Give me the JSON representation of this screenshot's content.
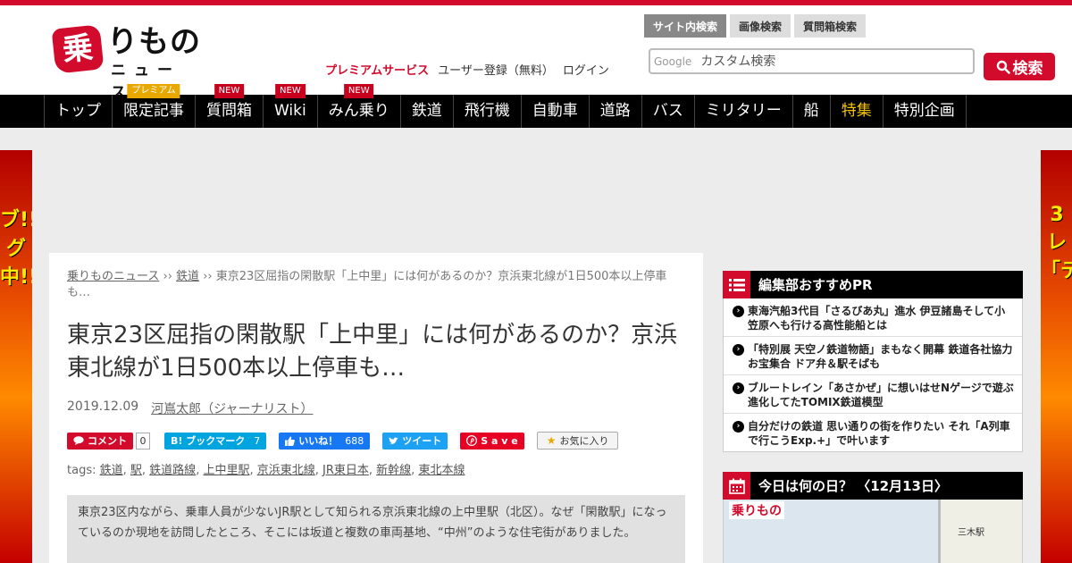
{
  "header": {
    "logo_mark": "乗",
    "logo_text": "りもの",
    "logo_sub": "ニュース",
    "premium_link": "プレミアムサービス",
    "register_link": "ユーザー登録（無料）",
    "login_link": "ログイン",
    "search_tabs": [
      "サイト内検索",
      "画像検索",
      "質問箱検索"
    ],
    "google_label": "Google",
    "search_placeholder": "カスタム検索",
    "search_button": "検索"
  },
  "nav": [
    {
      "label": "トップ",
      "badge": ""
    },
    {
      "label": "限定記事",
      "badge": "プレミアム"
    },
    {
      "label": "質問箱",
      "badge": "NEW"
    },
    {
      "label": "Wiki",
      "badge": "NEW"
    },
    {
      "label": "みん乗り",
      "badge": "NEW"
    },
    {
      "label": "鉄道",
      "badge": ""
    },
    {
      "label": "飛行機",
      "badge": ""
    },
    {
      "label": "自動車",
      "badge": ""
    },
    {
      "label": "道路",
      "badge": ""
    },
    {
      "label": "バス",
      "badge": ""
    },
    {
      "label": "ミリタリー",
      "badge": ""
    },
    {
      "label": "船",
      "badge": ""
    },
    {
      "label": "特集",
      "badge": ""
    },
    {
      "label": "特別企画",
      "badge": ""
    }
  ],
  "side_ads": {
    "left": "ブ!!グ中!!",
    "right": "3レ「テ"
  },
  "article": {
    "breadcrumb": [
      "乗りものニュース",
      "鉄道",
      "東京23区屈指の閑散駅「上中里」には何があるのか？京浜東北線が1日500本以上停車も…"
    ],
    "breadcrumb_sep": "››",
    "title": "東京23区屈指の閑散駅「上中里」には何があるのか？京浜東北線が1日500本以上停車も…",
    "date": "2019.12.09",
    "author": "河嶌太郎（ジャーナリスト）",
    "share": {
      "comment": "コメント",
      "comment_count": "0",
      "hatena": "B! ブックマーク",
      "hatena_count": "7",
      "like": "いいね！",
      "like_count": "688",
      "tweet": "ツイート",
      "pin": "S a v e",
      "fav": "お気に入り"
    },
    "tags_label": "tags:",
    "tags": [
      "鉄道",
      "駅",
      "鉄道路線",
      "上中里駅",
      "京浜東北線",
      "JR東日本",
      "新幹線",
      "東北本線"
    ],
    "lead": "東京23区内ながら、乗車人員が少ないJR駅として知られる京浜東北線の上中里駅（北区）。なぜ「閑散駅」になっているのか現地を訪問したところ、そこには坂道と複数の車両基地、“中州”のような住宅街がありました。"
  },
  "sidebar": {
    "pr_title": "編集部おすすめPR",
    "pr_items": [
      "東海汽船3代目「さるびあ丸」進水 伊豆諸島そして小笠原へも行ける高性能船とは",
      "「特別展 天空ノ鉄道物語」まもなく開幕 鉄道各社協力お宝集合 ドア弁＆駅そばも",
      "ブルートレイン「あさかぜ」に想いはせNゲージで遊ぶ 進化してたTOMIX鉄道模型",
      "自分だけの鉄道 思い通りの街を作りたい それ「A列車で行こうExp.+」で叶います"
    ],
    "today_title": "今日は何の日？ 〈12月13日〉",
    "map_logo": "乗りもの",
    "map_label": "三木駅"
  },
  "colors": {
    "brand": "#d20a2c",
    "nav_bg": "#000000",
    "feature": "#f5c400",
    "premium_badge": "#e8a800"
  }
}
